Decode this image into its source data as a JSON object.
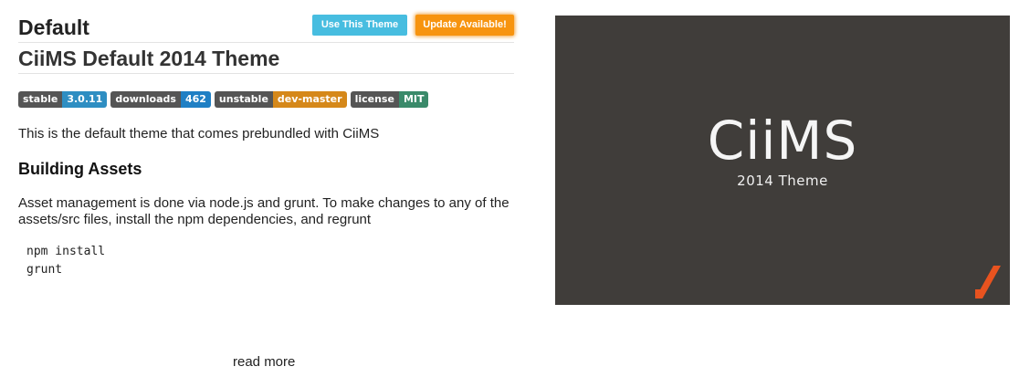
{
  "header": {
    "theme_name": "Default",
    "use_button": "Use This Theme",
    "update_button": "Update Available!"
  },
  "readme": {
    "title": "CiiMS Default 2014 Theme",
    "badges": [
      {
        "key": "stable",
        "value": "3.0.11",
        "color": "#2e8ec2"
      },
      {
        "key": "downloads",
        "value": "462",
        "color": "#1f7fc4"
      },
      {
        "key": "unstable",
        "value": "dev-master",
        "color": "#d5881a"
      },
      {
        "key": "license",
        "value": "MIT",
        "color": "#3a8a6a"
      }
    ],
    "intro": "This is the default theme that comes prebundled with CiiMS",
    "section_heading": "Building Assets",
    "section_text": "Asset management is done via node.js and grunt. To make changes to any of the assets/src files, install the npm dependencies, and regrunt",
    "code": "npm install\ngrunt"
  },
  "read_more": "read more",
  "preview": {
    "logo": "CiiMS",
    "subtitle": "2014 Theme",
    "background": "#403d3a",
    "accent": "#e8531f"
  }
}
